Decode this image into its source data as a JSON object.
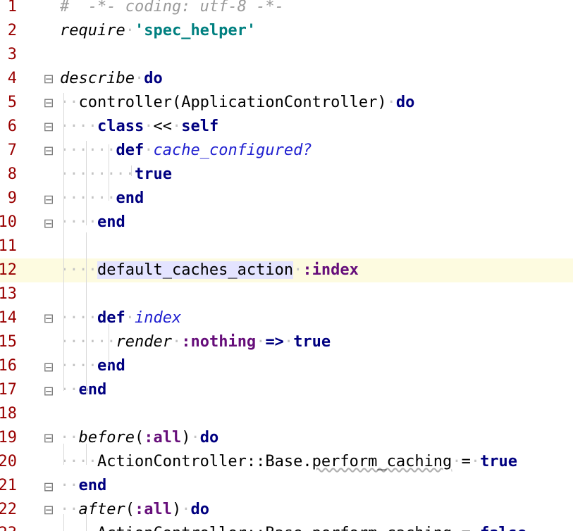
{
  "editor": {
    "lines": [
      {
        "num": "1",
        "fold": "",
        "tokens": [
          {
            "t": "cmt",
            "v": "#  -*- coding: utf-8 -*-"
          }
        ]
      },
      {
        "num": "2",
        "fold": "",
        "tokens": [
          {
            "t": "ital",
            "v": "require"
          },
          {
            "t": "ws",
            "v": "·"
          },
          {
            "t": "str",
            "v": "'spec_helper'"
          }
        ]
      },
      {
        "num": "3",
        "fold": "",
        "tokens": []
      },
      {
        "num": "4",
        "fold": "open",
        "tokens": [
          {
            "t": "ital",
            "v": "describe"
          },
          {
            "t": "ws",
            "v": "·"
          },
          {
            "t": "kw",
            "v": "do"
          }
        ]
      },
      {
        "num": "5",
        "fold": "open",
        "tokens": [
          {
            "t": "ws",
            "v": "··"
          },
          {
            "t": "plain",
            "v": "controller(ApplicationController)"
          },
          {
            "t": "ws",
            "v": "·"
          },
          {
            "t": "kw",
            "v": "do"
          }
        ]
      },
      {
        "num": "6",
        "fold": "open",
        "tokens": [
          {
            "t": "ws",
            "v": "····"
          },
          {
            "t": "kw",
            "v": "class"
          },
          {
            "t": "ws",
            "v": "·"
          },
          {
            "t": "plain",
            "v": "<<"
          },
          {
            "t": "ws",
            "v": "·"
          },
          {
            "t": "kw",
            "v": "self"
          }
        ]
      },
      {
        "num": "7",
        "fold": "open",
        "tokens": [
          {
            "t": "ws",
            "v": "······"
          },
          {
            "t": "kw",
            "v": "def"
          },
          {
            "t": "ws",
            "v": "·"
          },
          {
            "t": "fn",
            "v": "cache_configured?"
          }
        ]
      },
      {
        "num": "8",
        "fold": "",
        "tokens": [
          {
            "t": "ws",
            "v": "········"
          },
          {
            "t": "kw",
            "v": "true"
          }
        ]
      },
      {
        "num": "9",
        "fold": "close",
        "tokens": [
          {
            "t": "ws",
            "v": "······"
          },
          {
            "t": "kw",
            "v": "end"
          }
        ]
      },
      {
        "num": "10",
        "fold": "close",
        "tokens": [
          {
            "t": "ws",
            "v": "····"
          },
          {
            "t": "kw",
            "v": "end"
          }
        ]
      },
      {
        "num": "11",
        "fold": "",
        "tokens": []
      },
      {
        "num": "12",
        "fold": "",
        "current": true,
        "tokens": [
          {
            "t": "ws",
            "v": "····"
          },
          {
            "t": "hl",
            "v": "default_caches_action"
          },
          {
            "t": "ws",
            "v": "·"
          },
          {
            "t": "sym",
            "v": ":index"
          }
        ]
      },
      {
        "num": "13",
        "fold": "",
        "tokens": []
      },
      {
        "num": "14",
        "fold": "open",
        "tokens": [
          {
            "t": "ws",
            "v": "····"
          },
          {
            "t": "kw",
            "v": "def"
          },
          {
            "t": "ws",
            "v": "·"
          },
          {
            "t": "fn",
            "v": "index"
          }
        ]
      },
      {
        "num": "15",
        "fold": "",
        "tokens": [
          {
            "t": "ws",
            "v": "······"
          },
          {
            "t": "ital",
            "v": "render"
          },
          {
            "t": "ws",
            "v": "·"
          },
          {
            "t": "sym",
            "v": ":nothing"
          },
          {
            "t": "ws",
            "v": "·"
          },
          {
            "t": "kw",
            "v": "=>"
          },
          {
            "t": "ws",
            "v": "·"
          },
          {
            "t": "kw",
            "v": "true"
          }
        ]
      },
      {
        "num": "16",
        "fold": "close",
        "tokens": [
          {
            "t": "ws",
            "v": "····"
          },
          {
            "t": "kw",
            "v": "end"
          }
        ]
      },
      {
        "num": "17",
        "fold": "close",
        "tokens": [
          {
            "t": "ws",
            "v": "··"
          },
          {
            "t": "kw",
            "v": "end"
          }
        ]
      },
      {
        "num": "18",
        "fold": "",
        "tokens": []
      },
      {
        "num": "19",
        "fold": "open",
        "tokens": [
          {
            "t": "ws",
            "v": "··"
          },
          {
            "t": "ital",
            "v": "before"
          },
          {
            "t": "plain",
            "v": "("
          },
          {
            "t": "sym",
            "v": ":all"
          },
          {
            "t": "plain",
            "v": ")"
          },
          {
            "t": "ws",
            "v": "·"
          },
          {
            "t": "kw",
            "v": "do"
          }
        ]
      },
      {
        "num": "20",
        "fold": "",
        "tokens": [
          {
            "t": "ws",
            "v": "····"
          },
          {
            "t": "plain",
            "v": "ActionController::Base."
          },
          {
            "t": "warn",
            "v": "perform_caching"
          },
          {
            "t": "ws",
            "v": "·"
          },
          {
            "t": "plain",
            "v": "="
          },
          {
            "t": "ws",
            "v": "·"
          },
          {
            "t": "kw",
            "v": "true"
          }
        ]
      },
      {
        "num": "21",
        "fold": "close",
        "tokens": [
          {
            "t": "ws",
            "v": "··"
          },
          {
            "t": "kw",
            "v": "end"
          }
        ]
      },
      {
        "num": "22",
        "fold": "open",
        "tokens": [
          {
            "t": "ws",
            "v": "··"
          },
          {
            "t": "ital",
            "v": "after"
          },
          {
            "t": "plain",
            "v": "("
          },
          {
            "t": "sym",
            "v": ":all"
          },
          {
            "t": "plain",
            "v": ")"
          },
          {
            "t": "ws",
            "v": "·"
          },
          {
            "t": "kw",
            "v": "do"
          }
        ]
      },
      {
        "num": "23",
        "fold": "",
        "tokens": [
          {
            "t": "ws",
            "v": "····"
          },
          {
            "t": "plain",
            "v": "ActionController::Base."
          },
          {
            "t": "warn",
            "v": "perform_caching"
          },
          {
            "t": "ws",
            "v": "·"
          },
          {
            "t": "plain",
            "v": "="
          },
          {
            "t": "ws",
            "v": "·"
          },
          {
            "t": "kw",
            "v": "false"
          }
        ]
      }
    ],
    "fold_icons": {
      "open": "fold-open-icon",
      "close": "fold-close-icon"
    }
  }
}
